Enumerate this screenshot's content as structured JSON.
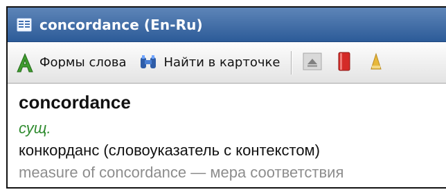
{
  "window": {
    "title": "concordance (En-Ru)"
  },
  "toolbar": {
    "word_forms_label": "Формы слова",
    "find_in_card_label": "Найти в карточке"
  },
  "entry": {
    "headword": "concordance",
    "part_of_speech": "сущ.",
    "translation": "конкорданс (словоуказатель с контекстом)",
    "example": "measure of concordance — мера соответствия"
  },
  "icons": {
    "app": "dictionary-card-icon",
    "word_forms": "letter-a-icon",
    "find_in_card": "binoculars-icon",
    "nav_up": "up-arrow-icon",
    "book": "red-book-icon",
    "extra": "yellow-icon"
  },
  "colors": {
    "title_bar": "#2c5b98",
    "part_of_speech": "#2f8b2f",
    "example": "#8d8d8d"
  }
}
